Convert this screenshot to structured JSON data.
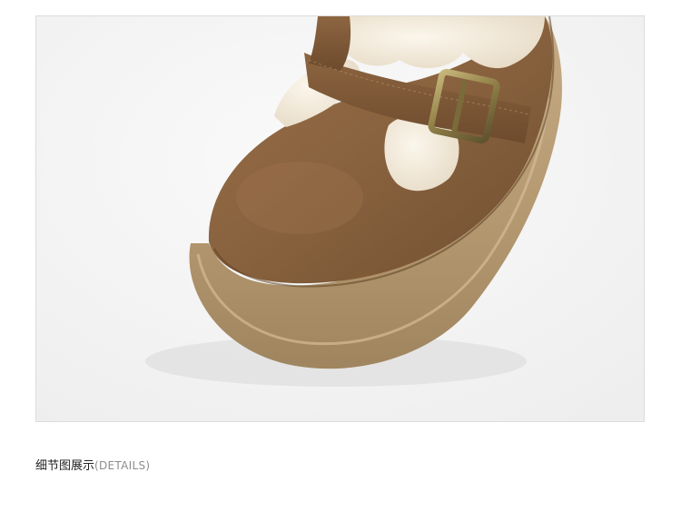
{
  "caption": {
    "zh": "细节图展示",
    "en": "(DETAILS)"
  },
  "colors": {
    "frame_border": "#dcdcdc",
    "background": "#f3f3f3",
    "suede": "#8b6440",
    "sole": "#b79a74",
    "shearling": "#f3eadb",
    "buckle": "#9a8a56"
  }
}
